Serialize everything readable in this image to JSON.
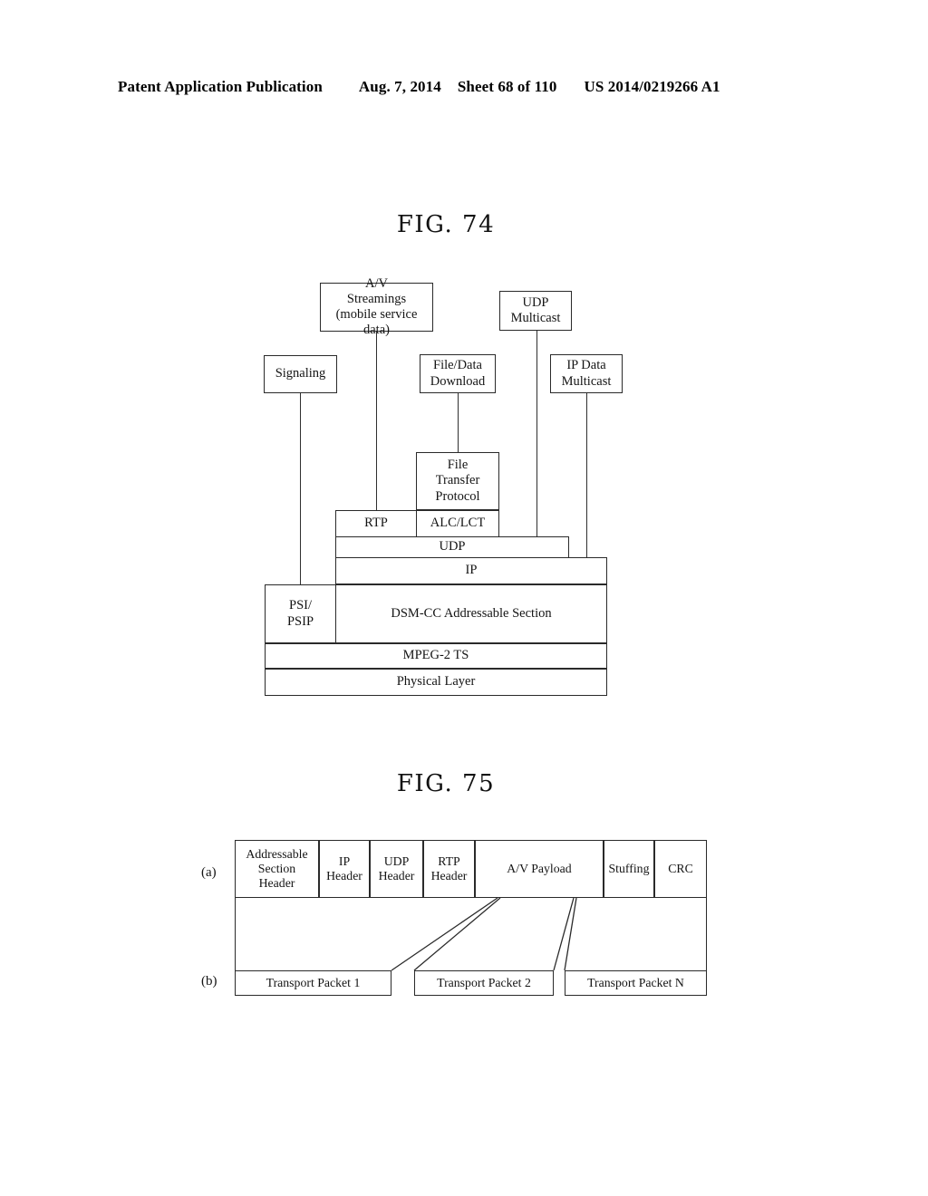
{
  "header": {
    "publication": "Patent Application Publication",
    "date": "Aug. 7, 2014",
    "sheet": "Sheet 68 of 110",
    "patent_number": "US 2014/0219266 A1"
  },
  "figures": [
    {
      "title": "FIG. 74",
      "blocks": {
        "av_streamings": "A/V\nStreamings\n(mobile service data)",
        "av_streamings_line1": "A/V",
        "av_streamings_line2": "Streamings",
        "av_streamings_line3": "(mobile service data)",
        "udp_multicast_line1": "UDP",
        "udp_multicast_line2": "Multicast",
        "signaling": "Signaling",
        "file_data_download_line1": "File/Data",
        "file_data_download_line2": "Download",
        "ip_data_multicast_line1": "IP Data",
        "ip_data_multicast_line2": "Multicast",
        "file_transfer_protocol_line1": "File",
        "file_transfer_protocol_line2": "Transfer",
        "file_transfer_protocol_line3": "Protocol",
        "rtp": "RTP",
        "alc_lct": "ALC/LCT",
        "udp": "UDP",
        "ip": "IP",
        "psi_psip_line1": "PSI/",
        "psi_psip_line2": "PSIP",
        "dsmcc": "DSM-CC Addressable Section",
        "mpeg2ts": "MPEG-2 TS",
        "physical_layer": "Physical Layer"
      }
    },
    {
      "title": "FIG. 75",
      "row_labels": {
        "a": "(a)",
        "b": "(b)"
      },
      "row_a_fields": [
        {
          "line1": "Addressable",
          "line2": "Section",
          "line3": "Header"
        },
        {
          "line1": "IP",
          "line2": "Header",
          "line3": ""
        },
        {
          "line1": "UDP",
          "line2": "Header",
          "line3": ""
        },
        {
          "line1": "RTP",
          "line2": "Header",
          "line3": ""
        },
        {
          "line1": "A/V Payload",
          "line2": "",
          "line3": ""
        },
        {
          "line1": "Stuffing",
          "line2": "",
          "line3": ""
        },
        {
          "line1": "CRC",
          "line2": "",
          "line3": ""
        }
      ],
      "row_b_packets": [
        {
          "label": "Transport Packet 1"
        },
        {
          "label": "Transport Packet 2"
        },
        {
          "label": "Transport Packet N"
        }
      ]
    }
  ]
}
